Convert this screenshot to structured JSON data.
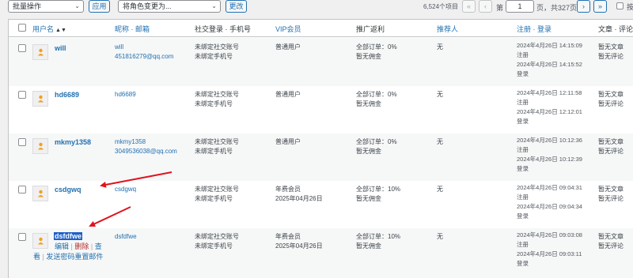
{
  "toolbar": {
    "bulk_action": "批量操作",
    "apply": "应用",
    "role_change": "将角色变更为...",
    "change": "更改",
    "item_count": "6,524个项目",
    "first": "«",
    "prev": "‹",
    "page_prefix": "第",
    "current_page": "1",
    "page_suffix": "页，共327页",
    "next": "›",
    "last": "»",
    "cutoff_label": "按"
  },
  "columns": {
    "username": "用户名",
    "nickname": "昵称 · 邮箱",
    "social": "社交登录 · 手机号",
    "vip": "VIP会员",
    "rebate": "推广返利",
    "referrer": "推荐人",
    "register": "注册 · 登录",
    "posts": "文章 · 评论"
  },
  "rows": [
    {
      "username": "will",
      "nickname": "will",
      "email": "451816279@qq.com",
      "social": "未绑定社交账号",
      "phone": "未绑定手机号",
      "vip": "普通用户",
      "vip_date": "",
      "rebate1": "全部订单：0%",
      "rebate2": "暂无佣金",
      "referrer": "无",
      "reg_time": "2024年4月26日 14:15:09",
      "reg_label": "注册",
      "login_time": "2024年4月26日 14:15:52",
      "login_label": "登录",
      "posts": "暂无文章",
      "comments": "暂无评论"
    },
    {
      "username": "hd6689",
      "nickname": "hd6689",
      "email": "",
      "social": "未绑定社交账号",
      "phone": "未绑定手机号",
      "vip": "普通用户",
      "vip_date": "",
      "rebate1": "全部订单：0%",
      "rebate2": "暂无佣金",
      "referrer": "无",
      "reg_time": "2024年4月26日 12:11:58",
      "reg_label": "注册",
      "login_time": "2024年4月26日 12:12:01",
      "login_label": "登录",
      "posts": "暂无文章",
      "comments": "暂无评论"
    },
    {
      "username": "mkmy1358",
      "nickname": "mkmy1358",
      "email": "3049536038@qq.com",
      "social": "未绑定社交账号",
      "phone": "未绑定手机号",
      "vip": "普通用户",
      "vip_date": "",
      "rebate1": "全部订单：0%",
      "rebate2": "暂无佣金",
      "referrer": "无",
      "reg_time": "2024年4月26日 10:12:36",
      "reg_label": "注册",
      "login_time": "2024年4月26日 10:12:39",
      "login_label": "登录",
      "posts": "暂无文章",
      "comments": "暂无评论"
    },
    {
      "username": "csdgwq",
      "nickname": "csdgwq",
      "email": "",
      "social": "未绑定社交账号",
      "phone": "未绑定手机号",
      "vip": "年费会员",
      "vip_date": "2025年04月26日",
      "rebate1": "全部订单：10%",
      "rebate2": "暂无佣金",
      "referrer": "无",
      "reg_time": "2024年4月26日 09:04:31",
      "reg_label": "注册",
      "login_time": "2024年4月26日 09:04:34",
      "login_label": "登录",
      "posts": "暂无文章",
      "comments": "暂无评论"
    },
    {
      "username": "dsfdfwe",
      "nickname": "dsfdfwe",
      "email": "",
      "social": "未绑定社交账号",
      "phone": "未绑定手机号",
      "vip": "年费会员",
      "vip_date": "2025年04月26日",
      "rebate1": "全部订单：10%",
      "rebate2": "暂无佣金",
      "referrer": "无",
      "reg_time": "2024年4月26日 09:03:08",
      "reg_label": "注册",
      "login_time": "2024年4月26日 09:03:11",
      "login_label": "登录",
      "posts": "暂无文章",
      "comments": "暂无评论",
      "action_edit": "编辑",
      "action_sep": "|",
      "action_delete": "删除",
      "action_sep2": "|",
      "action_view_a": "查",
      "action_view_b": "看",
      "action_sep3": "|",
      "action_reset": "发送密码重置邮件"
    }
  ],
  "colors": {
    "link": "#2271b1",
    "delete": "#b32d2e",
    "selection": "#1e5fc6",
    "arrow": "#e0141e"
  }
}
